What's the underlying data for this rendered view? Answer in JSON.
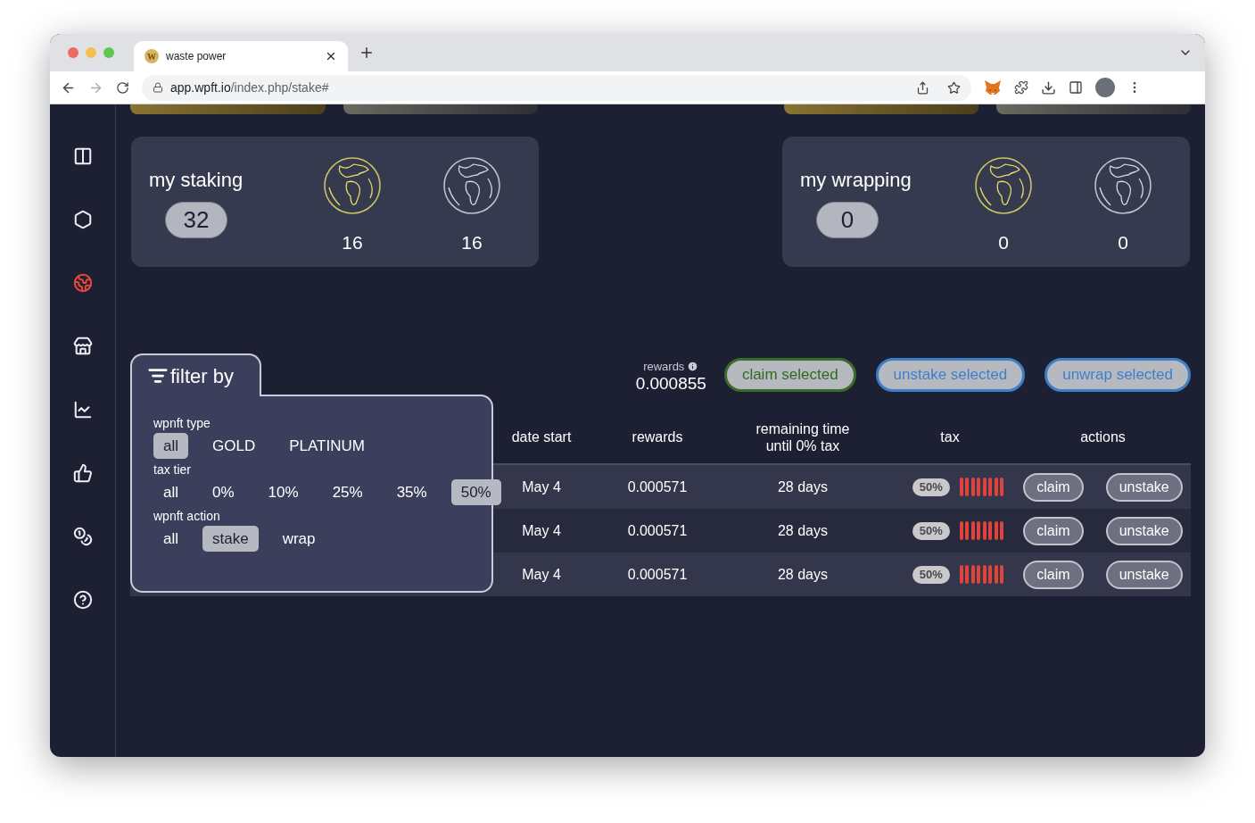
{
  "browser": {
    "tab": {
      "title": "waste power",
      "favicon": "W"
    },
    "url": {
      "host": "app.wpft.io",
      "path": "/index.php/stake#"
    }
  },
  "sidebar": {
    "items": [
      {
        "kind": "columns",
        "selected": false
      },
      {
        "kind": "nft",
        "selected": false
      },
      {
        "kind": "globe",
        "selected": true
      },
      {
        "kind": "store",
        "selected": false
      },
      {
        "kind": "chart",
        "selected": false
      },
      {
        "kind": "thumb",
        "selected": false
      },
      {
        "kind": "coins",
        "selected": false
      },
      {
        "kind": "help",
        "selected": false
      }
    ]
  },
  "summary_cards": [
    {
      "title": "my staking",
      "total": "32",
      "counts": [
        {
          "kind": "gold",
          "value": "16"
        },
        {
          "kind": "silver",
          "value": "16"
        }
      ]
    },
    {
      "title": "my wrapping",
      "total": "0",
      "counts": [
        {
          "kind": "gold",
          "value": "0"
        },
        {
          "kind": "silver",
          "value": "0"
        }
      ]
    }
  ],
  "rewards": {
    "label": "rewards",
    "value": "0.000855"
  },
  "actions": [
    {
      "kind": "claim",
      "label": "claim selected"
    },
    {
      "kind": "unstake",
      "label": "unstake selected"
    },
    {
      "kind": "unwrap",
      "label": "unwrap selected"
    }
  ],
  "filter": {
    "title": "filter by",
    "groups": [
      {
        "label": "wpnft type",
        "options": [
          {
            "label": "all",
            "selected": true
          },
          {
            "label": "GOLD",
            "selected": false
          },
          {
            "label": "PLATINUM",
            "selected": false
          }
        ]
      },
      {
        "label": "tax tier",
        "options": [
          {
            "label": "all",
            "selected": false
          },
          {
            "label": "0%",
            "selected": false
          },
          {
            "label": "10%",
            "selected": false
          },
          {
            "label": "25%",
            "selected": false
          },
          {
            "label": "35%",
            "selected": false
          },
          {
            "label": "50%",
            "selected": true
          }
        ]
      },
      {
        "label": "wpnft action",
        "options": [
          {
            "label": "all",
            "selected": false
          },
          {
            "label": "stake",
            "selected": true
          },
          {
            "label": "wrap",
            "selected": false
          }
        ]
      }
    ]
  },
  "table": {
    "columns": [
      "date start",
      "rewards",
      "remaining time until 0% tax",
      "tax",
      "actions"
    ],
    "rows": [
      {
        "date_start": "May 4",
        "rewards": "0.000571",
        "remaining": "28 days",
        "tax": "50%",
        "level": 1,
        "buttons": [
          "claim",
          "unstake"
        ]
      },
      {
        "date_start": "May 4",
        "rewards": "0.000571",
        "remaining": "28 days",
        "tax": "50%",
        "level": 1,
        "buttons": [
          "claim",
          "unstake"
        ]
      },
      {
        "date_start": "May 4",
        "rewards": "0.000571",
        "remaining": "28 days",
        "tax": "50%",
        "level": 1,
        "buttons": [
          "claim",
          "unstake"
        ]
      }
    ]
  }
}
